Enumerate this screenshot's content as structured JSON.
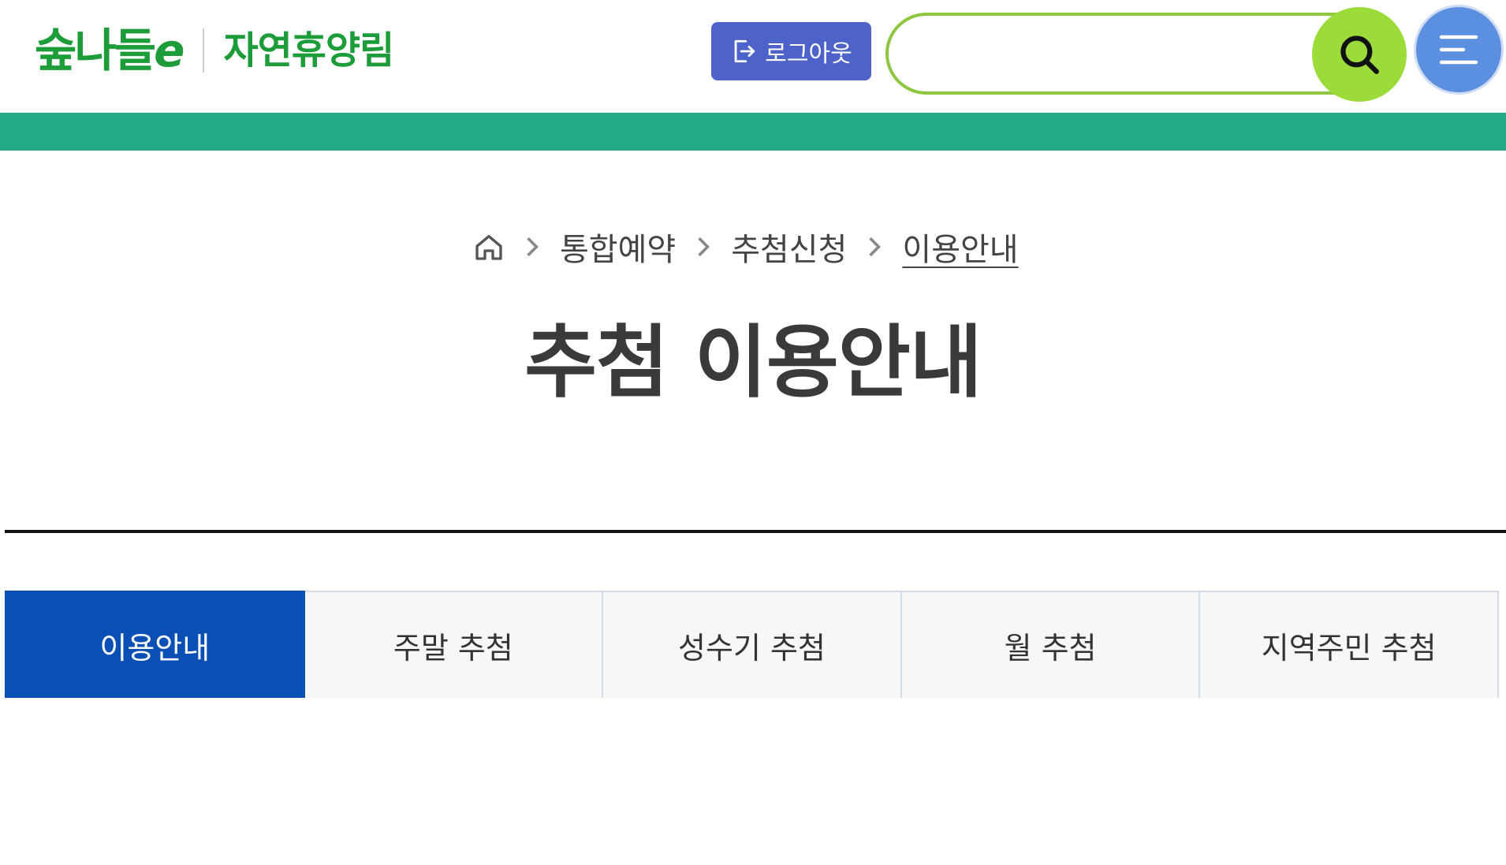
{
  "header": {
    "brand_name": "숲나들",
    "brand_e": "e",
    "brand_sub": "자연휴양림",
    "logout_label": "로그아웃",
    "search_placeholder": "",
    "icons": {
      "logout": "logout-icon",
      "search": "search-icon",
      "menu": "menu-icon"
    }
  },
  "breadcrumb": {
    "items": [
      "통합예약",
      "추첨신청",
      "이용안내"
    ]
  },
  "page": {
    "title": "추첨 이용안내"
  },
  "tabs": [
    {
      "label": "이용안내",
      "active": true
    },
    {
      "label": "주말 추첨",
      "active": false
    },
    {
      "label": "성수기 추첨",
      "active": false
    },
    {
      "label": "월 추첨",
      "active": false
    },
    {
      "label": "지역주민 추첨",
      "active": false
    }
  ],
  "colors": {
    "brand_green": "#1d9c3a",
    "band_green": "#22a986",
    "logout_blue": "#4d63c9",
    "search_green": "#9bdc3b",
    "menu_blue": "#5b8fdf",
    "tab_active": "#0a4fb5"
  }
}
